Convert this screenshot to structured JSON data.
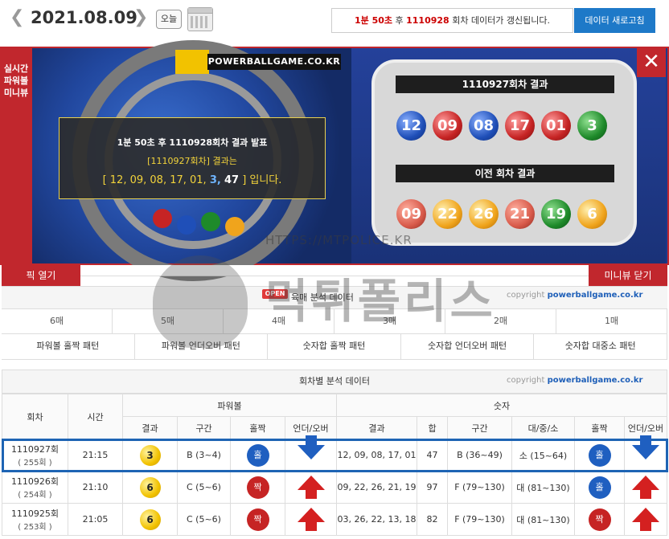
{
  "header": {
    "date": "2021.08.09",
    "today_label": "오늘",
    "notice_prefix": "1분 50초",
    "notice_mid": " 후 ",
    "notice_round": "1110928",
    "notice_suffix": " 회차 데이터가 갱신됩니다.",
    "refresh_label": "데이터 새로고침",
    "prev_icon": "chevron-left-icon",
    "next_icon": "chevron-right-icon"
  },
  "panel": {
    "side_tab": "실시간 파워볼 미니뷰",
    "brand": "POWERBALLGAME.CO.KR",
    "announce_line1": "1분 50초 후 1110928회차 결과 발표",
    "announce_line2": "[1110927회차] 결과는",
    "announce_nums": "[ 12, 09, 08, 17, 01,",
    "announce_pb": "3,",
    "announce_sum": "47",
    "announce_end": "] 입니다.",
    "current_title": "1110927회차 결과",
    "current_balls": [
      {
        "n": "12",
        "c": "blue"
      },
      {
        "n": "09",
        "c": "red"
      },
      {
        "n": "08",
        "c": "blue"
      },
      {
        "n": "17",
        "c": "red"
      },
      {
        "n": "01",
        "c": "red"
      },
      {
        "n": "3",
        "c": "green"
      }
    ],
    "prev_title": "이전 회차 결과",
    "prev_balls": [
      {
        "n": "09",
        "c": "rose"
      },
      {
        "n": "22",
        "c": "orange"
      },
      {
        "n": "26",
        "c": "orange"
      },
      {
        "n": "21",
        "c": "rose"
      },
      {
        "n": "19",
        "c": "green"
      },
      {
        "n": "6",
        "c": "orange"
      }
    ],
    "close_icon": "close-icon",
    "pick_open": "픽 열기",
    "miniview_close": "미니뷰 닫기"
  },
  "analysis": {
    "open_badge": "OPEN",
    "title": "육매 분석 데이터",
    "copyright_prefix": "copyright",
    "copyright_site": "powerballgame.co.kr",
    "counts": [
      "6매",
      "5매",
      "4매",
      "3매",
      "2매",
      "1매"
    ],
    "patterns": [
      "파워볼 홀짝 패턴",
      "파워볼 언더오버 패턴",
      "숫자합 홀짝 패턴",
      "숫자합 언더오버 패턴",
      "숫자합 대중소 패턴"
    ]
  },
  "table": {
    "title": "회차별 분석 데이터",
    "copyright_prefix": "copyright",
    "copyright_site": "powerballgame.co.kr",
    "h_round": "회차",
    "h_time": "시간",
    "h_powerball": "파워볼",
    "h_numbers": "숫자",
    "pb_cols": [
      "결과",
      "구간",
      "홀짝",
      "언더/오버"
    ],
    "num_cols": [
      "결과",
      "합",
      "구간",
      "대/중/소",
      "홀짝",
      "언더/오버"
    ],
    "rows": [
      {
        "round": "1110927회",
        "sub": "( 255회 )",
        "time": "21:15",
        "pb": "3",
        "pb_sec": "B (3~4)",
        "pb_oe": "홀",
        "pb_oe_c": "b",
        "pb_uo": "down",
        "nums": "12, 09, 08, 17, 01",
        "sum": "47",
        "sec": "B (36~49)",
        "size": "소 (15~64)",
        "oe": "홀",
        "oe_c": "b",
        "uo": "down"
      },
      {
        "round": "1110926회",
        "sub": "( 254회 )",
        "time": "21:10",
        "pb": "6",
        "pb_sec": "C (5~6)",
        "pb_oe": "짝",
        "pb_oe_c": "r",
        "pb_uo": "up",
        "nums": "09, 22, 26, 21, 19",
        "sum": "97",
        "sec": "F (79~130)",
        "size": "대 (81~130)",
        "oe": "홀",
        "oe_c": "b",
        "uo": "up"
      },
      {
        "round": "1110925회",
        "sub": "( 253회 )",
        "time": "21:05",
        "pb": "6",
        "pb_sec": "C (5~6)",
        "pb_oe": "짝",
        "pb_oe_c": "r",
        "pb_uo": "up",
        "nums": "03, 26, 22, 13, 18",
        "sum": "82",
        "sec": "F (79~130)",
        "size": "대 (81~130)",
        "oe": "짝",
        "oe_c": "r",
        "uo": "up"
      }
    ]
  },
  "watermark": {
    "url": "HTTPS://MTPOLICE.KR",
    "text": "먹튀폴리스"
  },
  "colors": {
    "accent_red": "#c1272d",
    "accent_blue": "#1e79c8",
    "panel_blue": "#1a3a8a"
  }
}
